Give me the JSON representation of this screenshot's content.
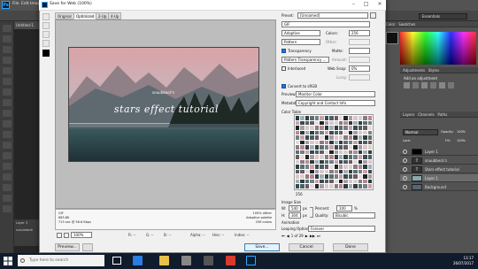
{
  "photoshop": {
    "logo": "Ps",
    "menu": [
      "File",
      "Edit",
      "Image"
    ],
    "workspace": "Essentials",
    "doc_tab": "Untitled-1",
    "panels": {
      "color_tabs": [
        "Color",
        "Swatches"
      ],
      "adjustments_tabs": [
        "Adjustments",
        "Styles"
      ],
      "adjustments_label": "Add an adjustment",
      "layers_tabs": [
        "Layers",
        "Channels",
        "Paths"
      ],
      "blend_mode": "Normal",
      "opacity_label": "Opacity:",
      "opacity_value": "100%",
      "lock_label": "Lock:",
      "fill_label": "Fill:",
      "fill_value": "100%",
      "layers": [
        "Layer 1",
        "snuubbeck's",
        "Stars effect tutorial",
        "Layer 1",
        "Background"
      ],
      "mini_layers": [
        "Layer 3",
        "snuubbeck"
      ]
    }
  },
  "dialog": {
    "title": "Save for Web (100%)",
    "tabs": [
      "Original",
      "Optimized",
      "2-Up",
      "4-Up"
    ],
    "active_tab": "Optimized",
    "image": {
      "small_text": "snuubbeck's",
      "title_text": "stars effect tutorial"
    },
    "info_left": [
      "GIF",
      "685.8K",
      "715 sec @ 56.6 Kbps"
    ],
    "info_right": [
      "100% dither",
      "Adaptive palette",
      "256 colors"
    ],
    "zoom": "100%",
    "status": [
      {
        "label": "R:",
        "value": "--"
      },
      {
        "label": "G:",
        "value": "--"
      },
      {
        "label": "B:",
        "value": "--"
      },
      {
        "label": "Alpha:",
        "value": "--"
      },
      {
        "label": "Hex:",
        "value": "--"
      },
      {
        "label": "Index:",
        "value": "--"
      }
    ],
    "preset_label": "Preset:",
    "preset_value": "[Unnamed]",
    "format": "GIF",
    "reduction": "Adaptive",
    "colors_label": "Colors:",
    "colors_value": "256",
    "dither_algo": "Pattern",
    "dither_label": "Other:",
    "transparency_label": "Transparency",
    "matte_label": "Matte:",
    "trans_dither": "Pattern Transparency ...",
    "amount_label": "Amount:",
    "interlaced_label": "Interlaced",
    "websnap_label": "Web Snap:",
    "websnap_value": "0%",
    "lossy_label": "Lossy:",
    "convert_srgb_label": "Convert to sRGB",
    "preview_label": "Preview:",
    "preview_value": "Monitor Color",
    "metadata_label": "Metadata:",
    "metadata_value": "Copyright and Contact Info",
    "color_table_label": "Color Table",
    "color_count": "256",
    "image_size_label": "Image Size",
    "w_label": "W:",
    "w_value": "540",
    "h_label": "H:",
    "h_value": "304",
    "px": "px",
    "percent_label": "Percent:",
    "percent_value": "100",
    "percent_unit": "%",
    "quality_label": "Quality:",
    "quality_value": "Bicubic",
    "animation_label": "Animation",
    "looping_label": "Looping Options:",
    "looping_value": "Forever",
    "frame_counter": "1 of 29",
    "buttons": {
      "preview": "Preview...",
      "save": "Save...",
      "cancel": "Cancel",
      "done": "Done"
    }
  },
  "taskbar": {
    "search_placeholder": "Type here to search",
    "time": "13:17",
    "date": "26/07/2017"
  }
}
